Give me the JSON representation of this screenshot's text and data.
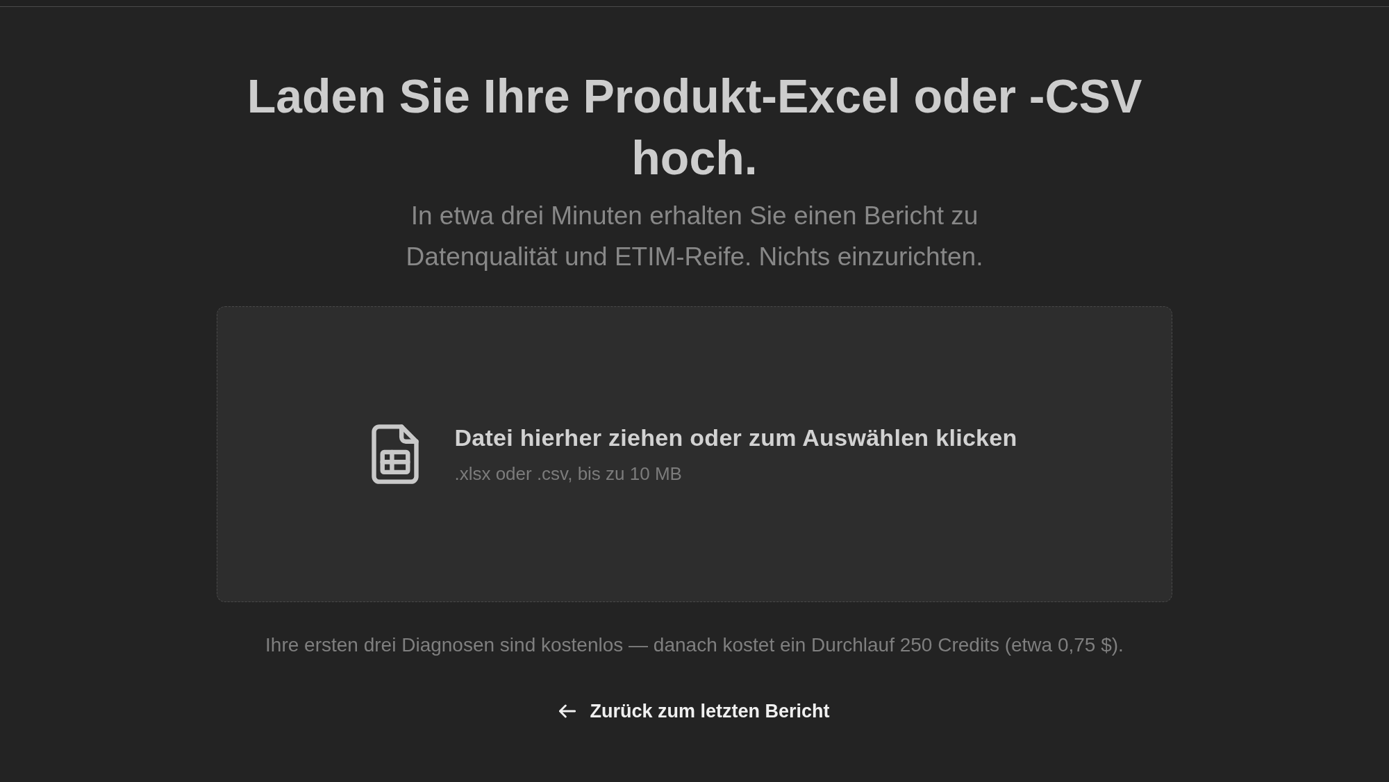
{
  "title": "Laden Sie Ihre Produkt-Excel oder -CSV hoch.",
  "subtitle": "In etwa drei Minuten erhalten Sie einen Bericht zu Datenqualität und ETIM-Reife. Nichts einzurichten.",
  "dropzone": {
    "label": "Datei hierher ziehen oder zum Auswählen klicken",
    "hint": ".xlsx oder .csv, bis zu 10 MB"
  },
  "pricing_note": "Ihre ersten drei Diagnosen sind kostenlos — danach kostet ein Durchlauf 250 Credits (etwa 0,75 $).",
  "back_link": {
    "label": "Zurück zum letzten Bericht"
  }
}
